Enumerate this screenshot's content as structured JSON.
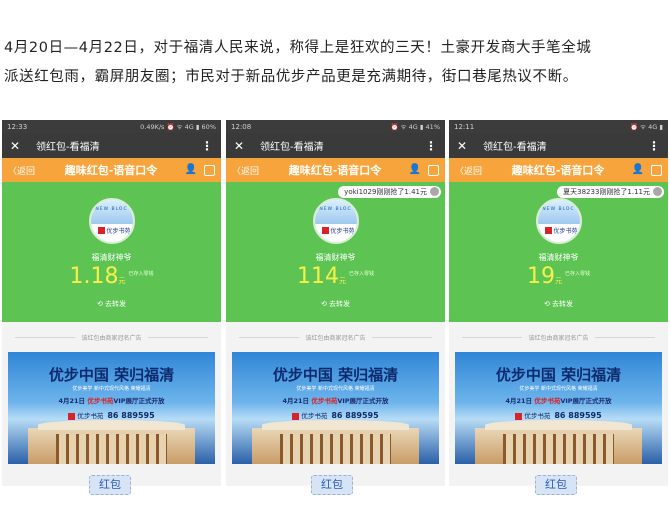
{
  "article": {
    "line1": "4月20日—4月22日，对于福清人民来说，称得上是狂欢的三天！土豪开发商大手笔全城",
    "line2": "派送红包雨，霸屏朋友圈；市民对于新品优步产品更是充满期待，街口巷尾热议不断。"
  },
  "screens": [
    {
      "status_time": "12:33",
      "status_right": "0.49K/s ⏰ ᯤ 4G ▮ 60%",
      "title": "领红包-看福清",
      "back": "〈返回",
      "orange_title": "趣味红包-语音口令",
      "notice": "",
      "sender": "福清财神爷",
      "amount": "1.18",
      "unit": "元",
      "amount_label": "已存入零钱",
      "share": "去转发",
      "ad_divider": "该红包由商家冠名广告"
    },
    {
      "status_time": "12:08",
      "status_right": "⏰ ᯤ 4G ▮ 41%",
      "title": "领红包-看福清",
      "back": "〈返回",
      "orange_title": "趣味红包-语音口令",
      "notice": "yoki1029刚刚抢了1.41元",
      "sender": "福清财神爷",
      "amount": "114",
      "unit": "元",
      "amount_label": "已存入零钱",
      "share": "去转发",
      "ad_divider": "该红包由商家冠名广告"
    },
    {
      "status_time": "12:11",
      "status_right": "⏰ ᯤ 4G ▮",
      "title": "领红包-看福清",
      "back": "〈返回",
      "orange_title": "趣味红包-语音口令",
      "notice": "夏天38233刚刚抢了1.11元",
      "sender": "福清财神爷",
      "amount": "19",
      "unit": "元",
      "amount_label": "已存入零钱",
      "share": "去转发",
      "ad_divider": "该红包由商家冠名广告"
    }
  ],
  "ad": {
    "headline": "优步中国  荣归福清",
    "sub1": "优步美学 新中式现代风格  荣耀福清",
    "date": "4月21日",
    "highlight": "优步书苑",
    "sub2_rest": "VIP展厅正式开放",
    "brand": "优步书苑",
    "tel": "86 889595"
  },
  "tags": [
    "红包",
    "红包",
    "红包"
  ]
}
